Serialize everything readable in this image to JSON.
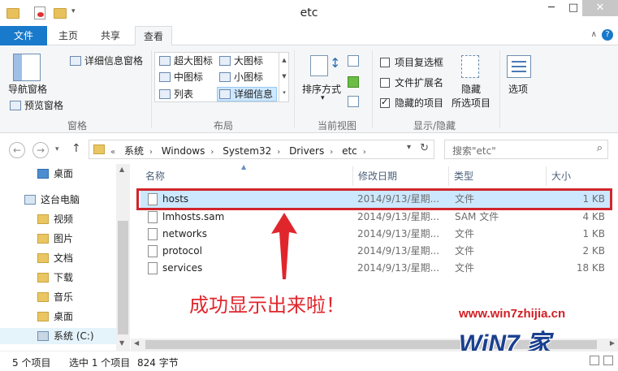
{
  "window": {
    "title": "etc",
    "minimize": "─",
    "maximize": "□",
    "close": "✕"
  },
  "tabs": {
    "file": "文件",
    "home": "主页",
    "share": "共享",
    "view": "查看",
    "help": "?"
  },
  "ribbon": {
    "panes": {
      "nav_pane": "导航窗格",
      "preview_pane": "预览窗格",
      "details_pane": "详细信息窗格",
      "group_label": "窗格"
    },
    "layout": {
      "extra_large": "超大图标",
      "large": "大图标",
      "medium": "中图标",
      "small": "小图标",
      "list": "列表",
      "details": "详细信息",
      "group_label": "布局"
    },
    "current_view": {
      "sort_by": "排序方式",
      "group_label": "当前视图"
    },
    "show_hide": {
      "item_checkboxes": "项目复选框",
      "file_extensions": "文件扩展名",
      "hidden_items": "隐藏的项目",
      "hide_selected_1": "隐藏",
      "hide_selected_2": "所选项目",
      "group_label": "显示/隐藏",
      "item_checkboxes_checked": false,
      "file_extensions_checked": false,
      "hidden_items_checked": true
    },
    "options": "选项"
  },
  "address": {
    "prefix": "«",
    "crumbs": [
      "系统",
      "Windows",
      "System32",
      "Drivers",
      "etc"
    ],
    "search_placeholder": "搜索\"etc\""
  },
  "nav_pane": {
    "items": [
      "桌面",
      "这台电脑",
      "视频",
      "图片",
      "文档",
      "下载",
      "音乐",
      "桌面",
      "系统 (C:)"
    ]
  },
  "columns": {
    "name": "名称",
    "modified": "修改日期",
    "type": "类型",
    "size": "大小"
  },
  "files": [
    {
      "name": "hosts",
      "modified": "2014/9/13/星期...",
      "type": "文件",
      "size": "1 KB",
      "selected": true
    },
    {
      "name": "lmhosts.sam",
      "modified": "2014/9/13/星期...",
      "type": "SAM 文件",
      "size": "4 KB",
      "selected": false
    },
    {
      "name": "networks",
      "modified": "2014/9/13/星期...",
      "type": "文件",
      "size": "1 KB",
      "selected": false
    },
    {
      "name": "protocol",
      "modified": "2014/9/13/星期...",
      "type": "文件",
      "size": "2 KB",
      "selected": false
    },
    {
      "name": "services",
      "modified": "2014/9/13/星期...",
      "type": "文件",
      "size": "18 KB",
      "selected": false
    }
  ],
  "annotation": {
    "text": "成功显示出来啦！",
    "color": "#e0262d"
  },
  "status": {
    "count": "5 个项目",
    "selected": "选中 1 个项目",
    "size": "824 字节"
  },
  "watermark": {
    "url": "www.win7zhijia.cn",
    "logo": "WiN7 家"
  },
  "colors": {
    "accent": "#1979ca",
    "selection": "#cce8ff",
    "highlight": "#d2252c"
  }
}
